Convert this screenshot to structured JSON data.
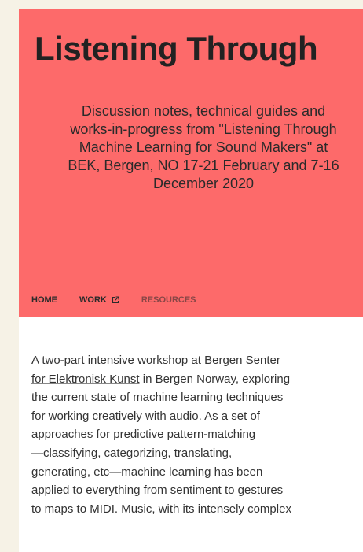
{
  "header": {
    "title": "Listening Through",
    "subtitle_lines": [
      "Discussion notes, technical guides and",
      "works-in-progress from \"Listening Through",
      "Machine Learning for Sound Makers\" at",
      "BEK, Bergen, NO 17-21 February and 7-16",
      "December 2020"
    ]
  },
  "nav": {
    "home": "HOME",
    "work": "WORK",
    "work_icon": "external-link-icon",
    "resources": "RESOURCES"
  },
  "intro": {
    "line1_pre": "A two-part intensive workshop at ",
    "link_part1": "Bergen Senter",
    "link_part2": "for Elektronisk Kunst",
    "line2_post": " in Bergen Norway, exploring",
    "lines": [
      "the current state of machine learning techniques",
      "for working creatively with audio. As a set of",
      "approaches for predictive pattern-matching",
      "—classifying, categorizing, translating,",
      "generating, etc—machine learning has been",
      "applied to everything from sentiment to gestures",
      "to maps to MIDI. Music, with its intensely complex"
    ]
  },
  "colors": {
    "hero_background": "#fd6a6a",
    "page_background": "#f6f2e6",
    "text": "#333333"
  }
}
